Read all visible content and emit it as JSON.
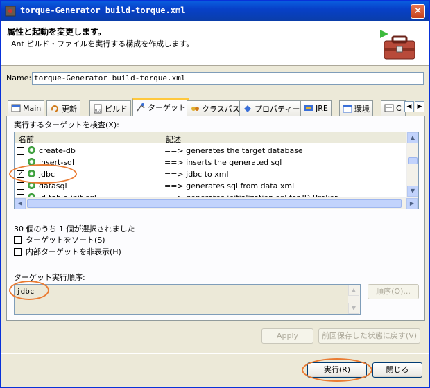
{
  "window": {
    "title": "torque-Generator build-torque.xml"
  },
  "header": {
    "title": "属性と起動を変更します。",
    "description": "Ant ビルド・ファイルを実行する構成を作成します。",
    "icon": "ant-toolbox-icon"
  },
  "name": {
    "label": "Name:",
    "value": "torque-Generator build-torque.xml"
  },
  "tabs": [
    {
      "label": "Main",
      "icon": "main-icon"
    },
    {
      "label": "更新",
      "icon": "refresh-icon"
    },
    {
      "label": "ビルド",
      "icon": "build-icon"
    },
    {
      "label": "ターゲット",
      "icon": "target-icon",
      "active": true
    },
    {
      "label": "クラスパス",
      "icon": "classpath-icon"
    },
    {
      "label": "プロパティー",
      "icon": "properties-icon"
    },
    {
      "label": "JRE",
      "icon": "jre-icon"
    },
    {
      "label": "環境",
      "icon": "environment-icon"
    },
    {
      "label": "C",
      "icon": "common-icon"
    }
  ],
  "targets_panel": {
    "check_label": "実行するターゲットを検査(X):",
    "columns": [
      "名前",
      "記述"
    ],
    "rows": [
      {
        "name": "create-db",
        "desc": "==> generates the target database",
        "checked": false
      },
      {
        "name": "insert-sql",
        "desc": "==> inserts the generated sql",
        "checked": false
      },
      {
        "name": "jdbc",
        "desc": "==> jdbc to xml",
        "checked": true
      },
      {
        "name": "datasql",
        "desc": "==> generates sql from data xml",
        "checked": false
      },
      {
        "name": "id-table-init-sql",
        "desc": "==> generates initialization sql for ID Broker",
        "checked": false
      }
    ],
    "selection_count": "30 個のうち 1 個が選択されました",
    "sort_label": "ターゲットをソート(S)",
    "hide_internal_label": "内部ターゲットを非表示(H)",
    "order_label": "ターゲット実行順序:",
    "order_value": "jdbc",
    "order_button": "順序(O)..."
  },
  "buttons": {
    "apply": "Apply",
    "revert": "前回保存した状態に戻す(V)",
    "run": "実行(R)",
    "close": "閉じる"
  },
  "colors": {
    "highlight": "#ea7b32",
    "titlebar": "#0a5fe0"
  }
}
